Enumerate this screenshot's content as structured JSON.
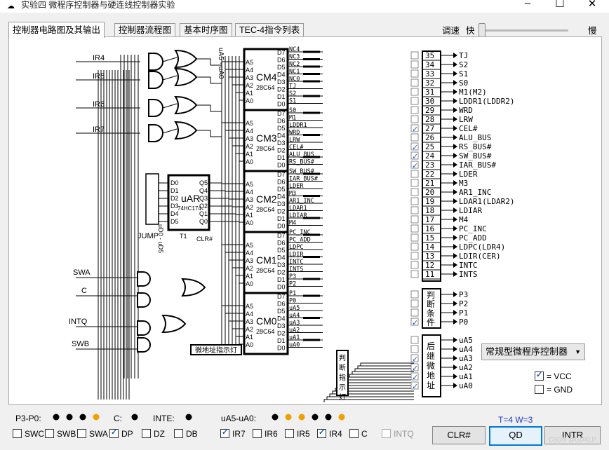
{
  "window": {
    "title": "实验四 微程序控制器与硬连线控制器实验",
    "controls": [
      "–",
      "☐",
      "✕"
    ]
  },
  "tabs": [
    {
      "label": "控制器电路图及其输出",
      "active": true
    },
    {
      "label": "控制器流程图",
      "active": false
    },
    {
      "label": "基本时序图",
      "active": false
    },
    {
      "label": "TEC-4指令列表",
      "active": false
    }
  ],
  "speed": {
    "label": "调速",
    "fast": "快",
    "slow": "慢"
  },
  "diagram": {
    "chips": [
      {
        "name": "CM4",
        "sub": "28C64"
      },
      {
        "name": "CM3",
        "sub": "28C64"
      },
      {
        "name": "CM2",
        "sub": "28C64"
      },
      {
        "name": "CM1",
        "sub": "28C64"
      },
      {
        "name": "CM0",
        "sub": "28C64"
      }
    ],
    "chip_inputs": [
      "A5",
      "A4",
      "A3",
      "A2",
      "A1",
      "A0"
    ],
    "chip_outputs": [
      "D7",
      "D6",
      "D5",
      "D4",
      "D3",
      "D2",
      "D1",
      "D0"
    ],
    "ua_label": "uA5 - uA0",
    "ud_label": "uD0 - uD5",
    "uar": {
      "name": "uAR",
      "sub": "74HC174",
      "inputs": [
        "D0",
        "D1",
        "D2",
        "D3",
        "D4",
        "D5"
      ],
      "outputs": [
        "Q5",
        "Q4",
        "Q3",
        "Q2",
        "Q1",
        "Q0"
      ],
      "t1": "T1",
      "clr": "CLR#"
    },
    "jump": "JUMP",
    "ir_inputs": [
      "IR4",
      "IR5",
      "IR6",
      "IR7"
    ],
    "left_inputs": [
      "SWA",
      "C",
      "INTQ",
      "SWB"
    ],
    "uaddr_lamp": "微地址指示灯",
    "judge_lamp": "判断指示灯",
    "signals": [
      [
        "NC4",
        "NC3",
        "NC2",
        "NC1",
        "NC0",
        "TJ",
        "S2",
        "S1"
      ],
      [
        "S0",
        "M1",
        "LDDR1",
        "WRD",
        "LRW",
        "CEL#",
        "ALU_BUS",
        "RS_BUS#"
      ],
      [
        "SW_BUS#",
        "IAR_BUS#",
        "LDER",
        "M3",
        "AR1_INC",
        "LDAR1",
        "LDIAR",
        "M4"
      ],
      [
        "PC_INC",
        "PC_ADD",
        "LDPC",
        "LDIR",
        "INTC",
        "INTS",
        "P3",
        "P2"
      ],
      [
        "P1",
        "P0",
        "uA5",
        "uA4",
        "uA3",
        "uA2",
        "uA1",
        "uA0"
      ]
    ]
  },
  "outputs": [
    {
      "num": "35",
      "label": "TJ",
      "checked": false
    },
    {
      "num": "34",
      "label": "S2",
      "checked": false
    },
    {
      "num": "33",
      "label": "S1",
      "checked": false
    },
    {
      "num": "32",
      "label": "S0",
      "checked": false
    },
    {
      "num": "31",
      "label": "M1(M2)",
      "checked": false
    },
    {
      "num": "30",
      "label": "LDDR1(LDDR2)",
      "checked": false
    },
    {
      "num": "29",
      "label": "WRD",
      "checked": false
    },
    {
      "num": "28",
      "label": "LRW",
      "checked": false
    },
    {
      "num": "27",
      "label": "CEL#",
      "checked": true
    },
    {
      "num": "26",
      "label": "ALU_BUS",
      "checked": false
    },
    {
      "num": "25",
      "label": "RS_BUS#",
      "checked": true
    },
    {
      "num": "24",
      "label": "SW_BUS#",
      "checked": true
    },
    {
      "num": "23",
      "label": "IAR_BUS#",
      "checked": true
    },
    {
      "num": "22",
      "label": "LDER",
      "checked": false
    },
    {
      "num": "21",
      "label": "M3",
      "checked": false
    },
    {
      "num": "20",
      "label": "AR1_INC",
      "checked": false
    },
    {
      "num": "19",
      "label": "LDAR1(LDAR2)",
      "checked": false
    },
    {
      "num": "18",
      "label": "LDIAR",
      "checked": false
    },
    {
      "num": "17",
      "label": "M4",
      "checked": false
    },
    {
      "num": "16",
      "label": "PC_INC",
      "checked": false
    },
    {
      "num": "15",
      "label": "PC_ADD",
      "checked": false
    },
    {
      "num": "14",
      "label": "LDPC(LDR4)",
      "checked": false
    },
    {
      "num": "13",
      "label": "LDIR(CER)",
      "checked": false
    },
    {
      "num": "12",
      "label": "INTC",
      "checked": false
    },
    {
      "num": "11",
      "label": "INTS",
      "checked": false
    }
  ],
  "judge": {
    "title": "判断条件",
    "items": [
      {
        "label": "P3",
        "checked": false
      },
      {
        "label": "P2",
        "checked": false
      },
      {
        "label": "P1",
        "checked": false
      },
      {
        "label": "P0",
        "checked": true
      }
    ]
  },
  "next_addr": {
    "title": "后继微地址",
    "items": [
      {
        "label": "uA5",
        "checked": false
      },
      {
        "label": "uA4",
        "checked": false
      },
      {
        "label": "uA3",
        "checked": true
      },
      {
        "label": "uA2",
        "checked": true
      },
      {
        "label": "uA1",
        "checked": true
      },
      {
        "label": "uA0",
        "checked": true
      }
    ]
  },
  "controller_select": {
    "value": "常规型微程序控制器"
  },
  "legend": {
    "vcc": "= VCC",
    "gnd": "= GND"
  },
  "status": {
    "p_label": "P3-P0:",
    "p_leds": [
      "#000000",
      "#000000",
      "#000000",
      "#f0a000"
    ],
    "c_label": "C:",
    "c_led": "#000000",
    "inte_label": "INTE:",
    "inte_led": "#000000",
    "ua_label": "uA5-uA0:",
    "ua_leds": [
      "#000000",
      "#f0a000",
      "#f0a000",
      "#000000",
      "#000000",
      "#f0a000"
    ]
  },
  "switches": [
    {
      "label": "SWC",
      "checked": false,
      "enabled": true
    },
    {
      "label": "SWB",
      "checked": false,
      "enabled": true
    },
    {
      "label": "SWA",
      "checked": false,
      "enabled": true
    },
    {
      "label": "DP",
      "checked": true,
      "enabled": true
    },
    {
      "label": "DZ",
      "checked": false,
      "enabled": true
    },
    {
      "label": "DB",
      "checked": false,
      "enabled": true
    }
  ],
  "ir_switches": [
    {
      "label": "IR7",
      "checked": true,
      "enabled": true
    },
    {
      "label": "IR6",
      "checked": false,
      "enabled": true
    },
    {
      "label": "IR5",
      "checked": false,
      "enabled": true
    },
    {
      "label": "IR4",
      "checked": true,
      "enabled": true
    },
    {
      "label": "C",
      "checked": false,
      "enabled": true
    },
    {
      "label": "INTQ",
      "checked": false,
      "enabled": false
    }
  ],
  "timing": "T=4  W=3",
  "buttons": {
    "clr": "CLR#",
    "qd": "QD",
    "intr": "INTR"
  },
  "watermark": "CSDN @GDXLP"
}
